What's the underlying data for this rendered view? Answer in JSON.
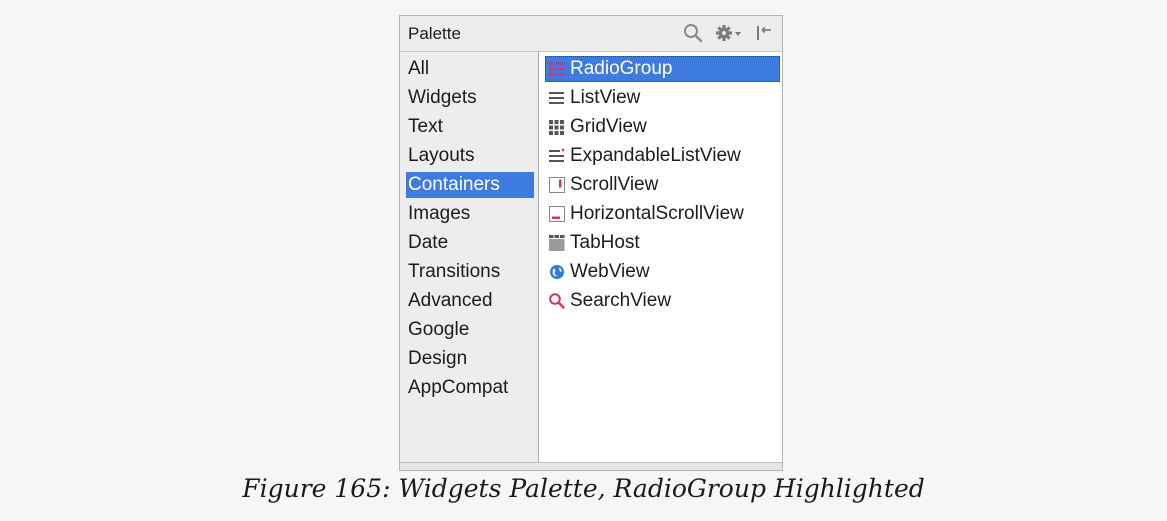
{
  "palette": {
    "title": "Palette",
    "header_icons": [
      "search-icon",
      "gear-dropdown-icon",
      "hide-panel-icon"
    ],
    "categories": [
      {
        "label": "All",
        "selected": false
      },
      {
        "label": "Widgets",
        "selected": false
      },
      {
        "label": "Text",
        "selected": false
      },
      {
        "label": "Layouts",
        "selected": false
      },
      {
        "label": "Containers",
        "selected": true
      },
      {
        "label": "Images",
        "selected": false
      },
      {
        "label": "Date",
        "selected": false
      },
      {
        "label": "Transitions",
        "selected": false
      },
      {
        "label": "Advanced",
        "selected": false
      },
      {
        "label": "Google",
        "selected": false
      },
      {
        "label": "Design",
        "selected": false
      },
      {
        "label": "AppCompat",
        "selected": false
      }
    ],
    "widgets": [
      {
        "label": "RadioGroup",
        "icon": "radiogroup-icon",
        "selected": true
      },
      {
        "label": "ListView",
        "icon": "listview-icon",
        "selected": false
      },
      {
        "label": "GridView",
        "icon": "gridview-icon",
        "selected": false
      },
      {
        "label": "ExpandableListView",
        "icon": "expandablelistview-icon",
        "selected": false
      },
      {
        "label": "ScrollView",
        "icon": "scrollview-icon",
        "selected": false
      },
      {
        "label": "HorizontalScrollView",
        "icon": "horizontalscrollview-icon",
        "selected": false
      },
      {
        "label": "TabHost",
        "icon": "tabhost-icon",
        "selected": false
      },
      {
        "label": "WebView",
        "icon": "webview-icon",
        "selected": false
      },
      {
        "label": "SearchView",
        "icon": "searchview-icon",
        "selected": false
      }
    ]
  },
  "caption": "Figure 165: Widgets Palette, RadioGroup Highlighted",
  "colors": {
    "selection": "#3d7be0",
    "accent_pink": "#d6336c",
    "globe_blue": "#2f7fd0"
  }
}
